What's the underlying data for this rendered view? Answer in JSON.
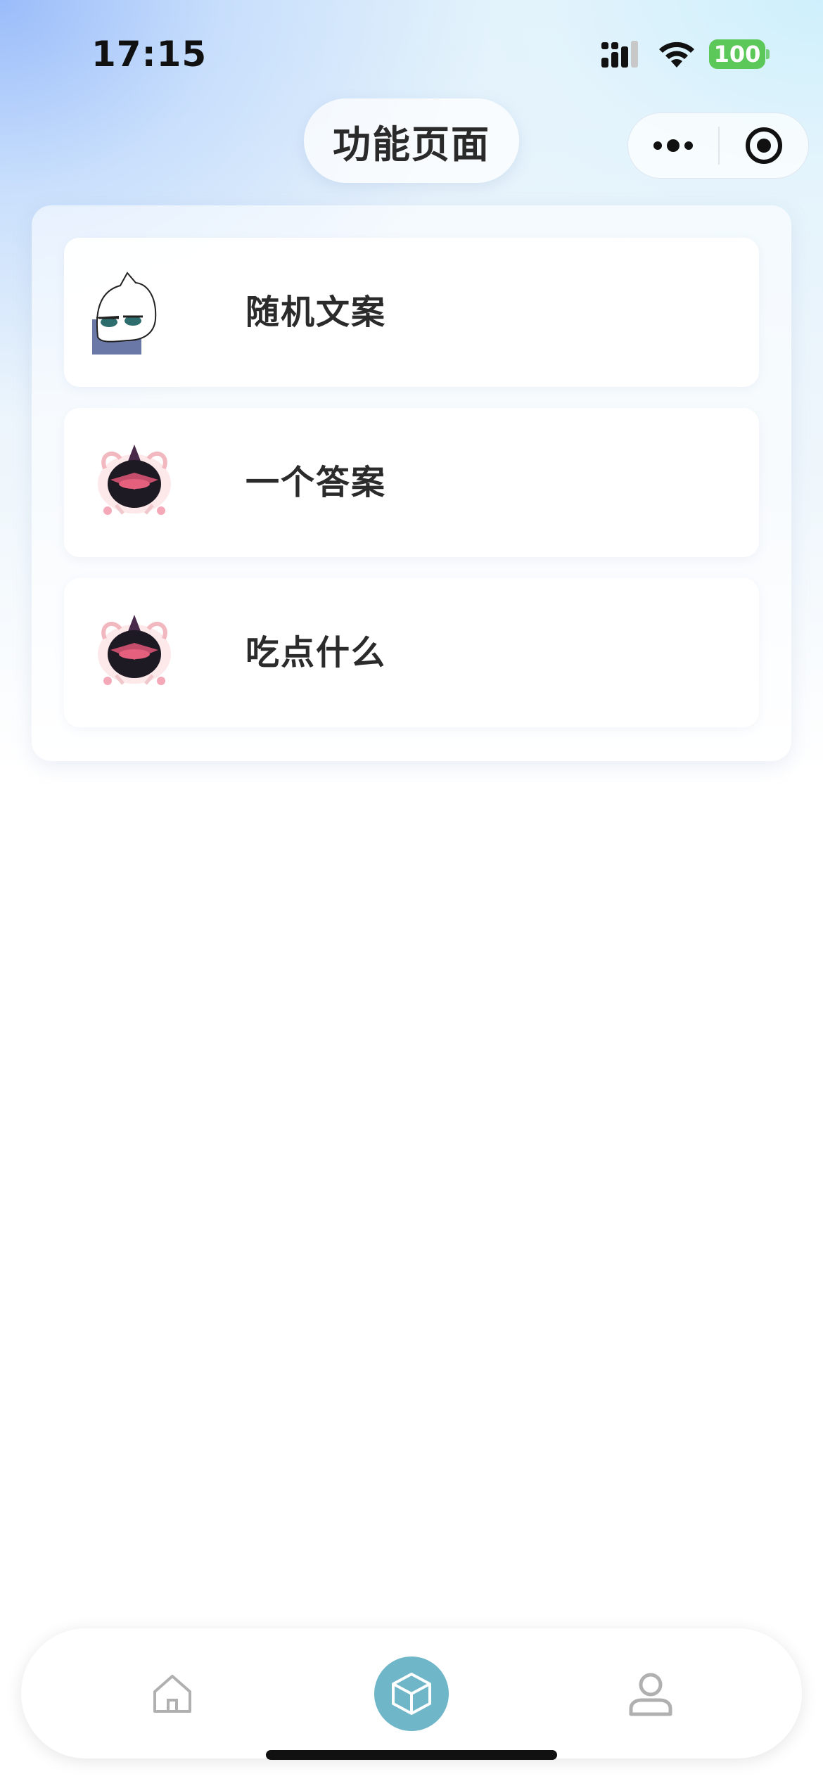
{
  "status_bar": {
    "time": "17:15",
    "battery": "100",
    "battery_color": "#5cc85a"
  },
  "nav": {
    "title": "功能页面",
    "more_icon": "more-dots-icon",
    "close_icon": "target-icon"
  },
  "features": [
    {
      "label": "随机文案",
      "icon": "cat-avatar-icon"
    },
    {
      "label": "一个答案",
      "icon": "creature-avatar-icon"
    },
    {
      "label": "吃点什么",
      "icon": "creature-avatar-icon"
    }
  ],
  "tabbar": {
    "tabs": [
      {
        "name": "home",
        "icon": "home-icon",
        "active": false
      },
      {
        "name": "functions",
        "icon": "cube-icon",
        "active": true,
        "active_color": "#6fb6c8"
      },
      {
        "name": "profile",
        "icon": "user-icon",
        "active": false
      }
    ]
  }
}
